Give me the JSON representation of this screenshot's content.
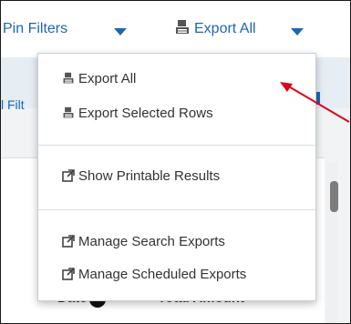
{
  "toolbar": {
    "pin_filters_label": "Pin Filters",
    "export_all_label": "Export All"
  },
  "background": {
    "filter_text_fragment": "l Filt",
    "column_fragment_left": "Date",
    "column_fragment_right": "Total Amount"
  },
  "menu": {
    "items": [
      {
        "label": "Export All",
        "icon": "export-icon"
      },
      {
        "label": "Export Selected Rows",
        "icon": "export-icon"
      },
      {
        "label": "Show Printable Results",
        "icon": "external-link-icon"
      },
      {
        "label": "Manage Search Exports",
        "icon": "external-link-icon"
      },
      {
        "label": "Manage Scheduled Exports",
        "icon": "external-link-icon"
      }
    ]
  },
  "colors": {
    "accent": "#1e66b5",
    "annotation_arrow": "#e0001b",
    "menu_text": "#333333"
  }
}
